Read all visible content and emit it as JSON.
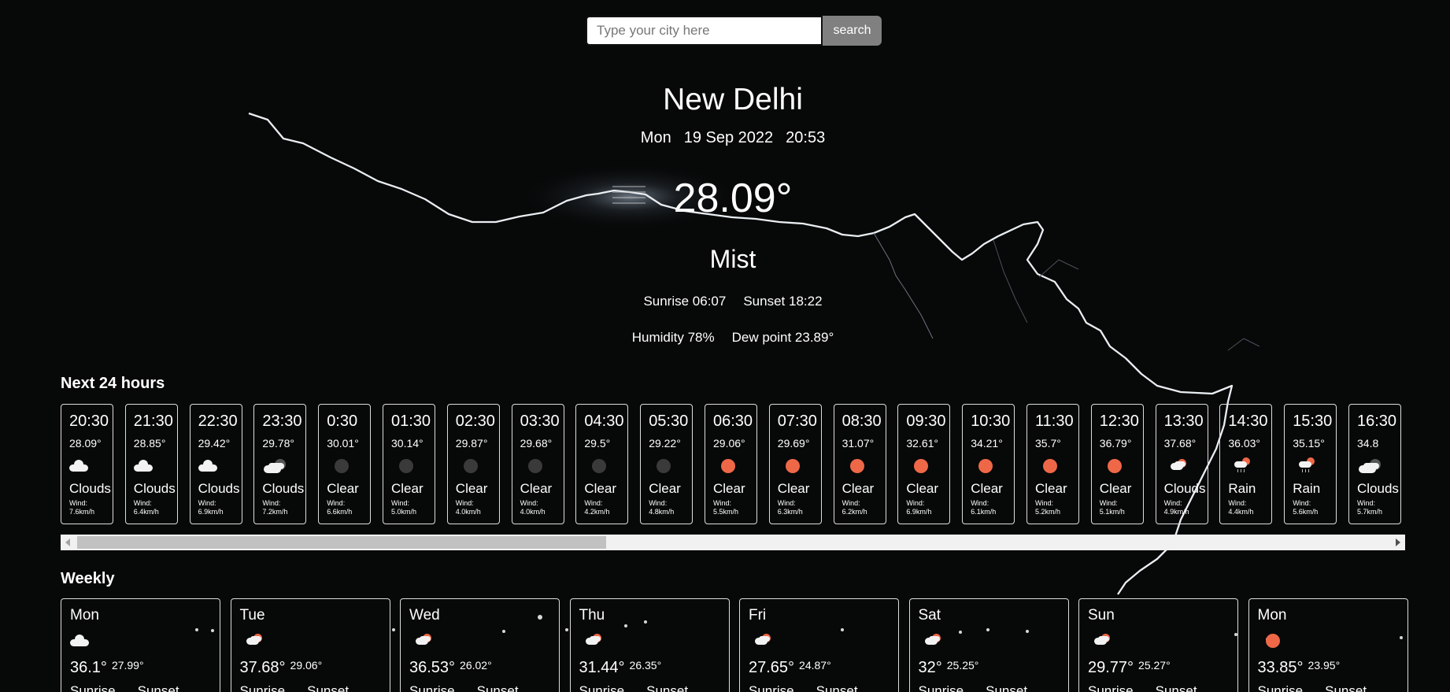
{
  "search": {
    "placeholder": "Type your city here",
    "button_label": "search"
  },
  "current": {
    "city": "New Delhi",
    "day": "Mon",
    "date": "19 Sep 2022",
    "time": "20:53",
    "temperature": "28.09°",
    "condition": "Mist",
    "condition_icon": "mist-icon",
    "sunrise": "Sunrise 06:07",
    "sunset": "Sunset 18:22",
    "humidity": "Humidity 78%",
    "dew_point": "Dew point 23.89°"
  },
  "hourly_title": "Next 24 hours",
  "hourly": [
    {
      "time": "20:30",
      "temp": "28.09°",
      "icon": "cloud-icon",
      "cond": "Clouds",
      "wind": "Wind: 7.6km/h"
    },
    {
      "time": "21:30",
      "temp": "28.85°",
      "icon": "cloud-icon",
      "cond": "Clouds",
      "wind": "Wind: 6.4km/h"
    },
    {
      "time": "22:30",
      "temp": "29.42°",
      "icon": "cloud-icon",
      "cond": "Clouds",
      "wind": "Wind: 6.9km/h"
    },
    {
      "time": "23:30",
      "temp": "29.78°",
      "icon": "cloud-night-icon",
      "cond": "Clouds",
      "wind": "Wind: 7.2km/h"
    },
    {
      "time": "0:30",
      "temp": "30.01°",
      "icon": "moon-icon",
      "cond": "Clear",
      "wind": "Wind: 6.6km/h"
    },
    {
      "time": "01:30",
      "temp": "30.14°",
      "icon": "moon-icon",
      "cond": "Clear",
      "wind": "Wind: 5.0km/h"
    },
    {
      "time": "02:30",
      "temp": "29.87°",
      "icon": "moon-icon",
      "cond": "Clear",
      "wind": "Wind: 4.0km/h"
    },
    {
      "time": "03:30",
      "temp": "29.68°",
      "icon": "moon-icon",
      "cond": "Clear",
      "wind": "Wind: 4.0km/h"
    },
    {
      "time": "04:30",
      "temp": "29.5°",
      "icon": "moon-icon",
      "cond": "Clear",
      "wind": "Wind: 4.2km/h"
    },
    {
      "time": "05:30",
      "temp": "29.22°",
      "icon": "moon-icon",
      "cond": "Clear",
      "wind": "Wind: 4.8km/h"
    },
    {
      "time": "06:30",
      "temp": "29.06°",
      "icon": "sun-icon",
      "cond": "Clear",
      "wind": "Wind: 5.5km/h"
    },
    {
      "time": "07:30",
      "temp": "29.69°",
      "icon": "sun-icon",
      "cond": "Clear",
      "wind": "Wind: 6.3km/h"
    },
    {
      "time": "08:30",
      "temp": "31.07°",
      "icon": "sun-icon",
      "cond": "Clear",
      "wind": "Wind: 6.2km/h"
    },
    {
      "time": "09:30",
      "temp": "32.61°",
      "icon": "sun-icon",
      "cond": "Clear",
      "wind": "Wind: 6.9km/h"
    },
    {
      "time": "10:30",
      "temp": "34.21°",
      "icon": "sun-icon",
      "cond": "Clear",
      "wind": "Wind: 6.1km/h"
    },
    {
      "time": "11:30",
      "temp": "35.7°",
      "icon": "sun-icon",
      "cond": "Clear",
      "wind": "Wind: 5.2km/h"
    },
    {
      "time": "12:30",
      "temp": "36.79°",
      "icon": "sun-icon",
      "cond": "Clear",
      "wind": "Wind: 5.1km/h"
    },
    {
      "time": "13:30",
      "temp": "37.68°",
      "icon": "sun-cloud-icon",
      "cond": "Clouds",
      "wind": "Wind: 4.9km/h"
    },
    {
      "time": "14:30",
      "temp": "36.03°",
      "icon": "rain-cloud-icon",
      "cond": "Rain",
      "wind": "Wind: 4.4km/h"
    },
    {
      "time": "15:30",
      "temp": "35.15°",
      "icon": "rain-cloud-icon",
      "cond": "Rain",
      "wind": "Wind: 5.6km/h"
    },
    {
      "time": "16:30",
      "temp": "34.8",
      "icon": "cloud-night-icon",
      "cond": "Clouds",
      "wind": "Wind: 5.7km/h"
    }
  ],
  "weekly_title": "Weekly",
  "weekly": [
    {
      "day": "Mon",
      "icon": "cloud-icon",
      "max": "36.1°",
      "min": "27.99°",
      "sunrise": "Sunrise",
      "sunset": "Sunset"
    },
    {
      "day": "Tue",
      "icon": "sun-cloud-icon",
      "max": "37.68°",
      "min": "29.06°",
      "sunrise": "Sunrise",
      "sunset": "Sunset"
    },
    {
      "day": "Wed",
      "icon": "sun-cloud-icon",
      "max": "36.53°",
      "min": "26.02°",
      "sunrise": "Sunrise",
      "sunset": "Sunset"
    },
    {
      "day": "Thu",
      "icon": "sun-cloud-icon",
      "max": "31.44°",
      "min": "26.35°",
      "sunrise": "Sunrise",
      "sunset": "Sunset"
    },
    {
      "day": "Fri",
      "icon": "sun-cloud-icon",
      "max": "27.65°",
      "min": "24.87°",
      "sunrise": "Sunrise",
      "sunset": "Sunset"
    },
    {
      "day": "Sat",
      "icon": "sun-cloud-icon",
      "max": "32°",
      "min": "25.25°",
      "sunrise": "Sunrise",
      "sunset": "Sunset"
    },
    {
      "day": "Sun",
      "icon": "sun-cloud-icon",
      "max": "29.77°",
      "min": "25.27°",
      "sunrise": "Sunrise",
      "sunset": "Sunset"
    },
    {
      "day": "Mon",
      "icon": "sun-icon",
      "max": "33.85°",
      "min": "23.95°",
      "sunrise": "Sunrise",
      "sunset": "Sunset"
    }
  ],
  "hourly_scroll_position": 0.0
}
